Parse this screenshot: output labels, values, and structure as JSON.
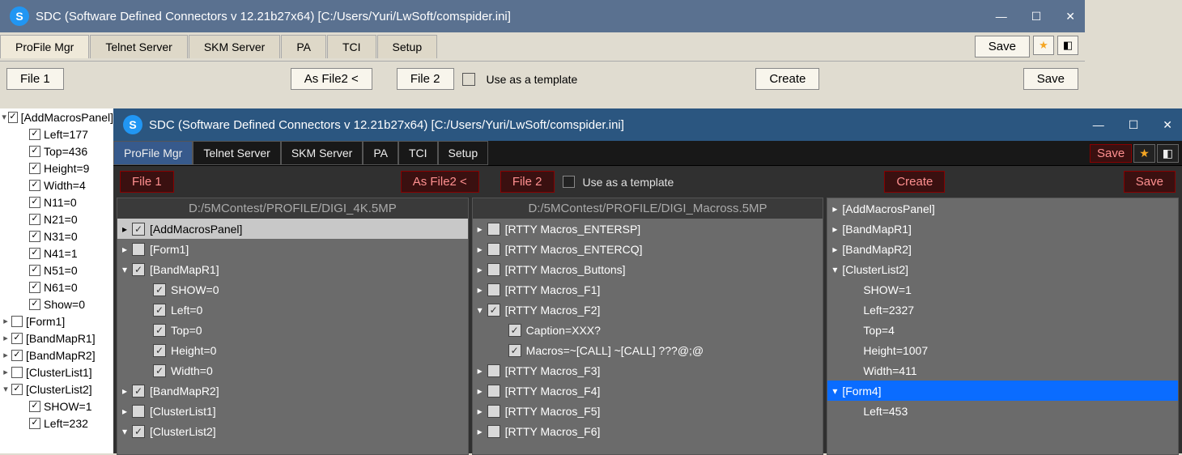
{
  "light": {
    "title": "SDC (Software Defined Connectors v 12.21b27x64) [C:/Users/Yuri/LwSoft/comspider.ini]",
    "tabs": [
      "ProFile Mgr",
      "Telnet Server",
      "SKM Server",
      "PA",
      "TCI",
      "Setup"
    ],
    "save": "Save",
    "file1": "File 1",
    "asfile2": "As File2 <",
    "file2": "File 2",
    "use_template": "Use as a template",
    "create": "Create",
    "save2": "Save",
    "tree": [
      {
        "d": 0,
        "tw": "▾",
        "cb": true,
        "t": "[AddMacrosPanel]"
      },
      {
        "d": 1,
        "tw": "",
        "cb": true,
        "t": "Left=177"
      },
      {
        "d": 1,
        "tw": "",
        "cb": true,
        "t": "Top=436"
      },
      {
        "d": 1,
        "tw": "",
        "cb": true,
        "t": "Height=9"
      },
      {
        "d": 1,
        "tw": "",
        "cb": true,
        "t": "Width=4"
      },
      {
        "d": 1,
        "tw": "",
        "cb": true,
        "t": "N11=0"
      },
      {
        "d": 1,
        "tw": "",
        "cb": true,
        "t": "N21=0"
      },
      {
        "d": 1,
        "tw": "",
        "cb": true,
        "t": "N31=0"
      },
      {
        "d": 1,
        "tw": "",
        "cb": true,
        "t": "N41=1"
      },
      {
        "d": 1,
        "tw": "",
        "cb": true,
        "t": "N51=0"
      },
      {
        "d": 1,
        "tw": "",
        "cb": true,
        "t": "N61=0"
      },
      {
        "d": 1,
        "tw": "",
        "cb": true,
        "t": "Show=0"
      },
      {
        "d": 0,
        "tw": "▸",
        "cb": false,
        "t": "[Form1]"
      },
      {
        "d": 0,
        "tw": "▸",
        "cb": true,
        "t": "[BandMapR1]"
      },
      {
        "d": 0,
        "tw": "▸",
        "cb": true,
        "t": "[BandMapR2]"
      },
      {
        "d": 0,
        "tw": "▸",
        "cb": false,
        "t": "[ClusterList1]"
      },
      {
        "d": 0,
        "tw": "▾",
        "cb": true,
        "t": "[ClusterList2]"
      },
      {
        "d": 1,
        "tw": "",
        "cb": true,
        "t": "SHOW=1"
      },
      {
        "d": 1,
        "tw": "",
        "cb": true,
        "t": "Left=232"
      }
    ]
  },
  "dark": {
    "title": "SDC (Software Defined Connectors v 12.21b27x64) [C:/Users/Yuri/LwSoft/comspider.ini]",
    "tabs": [
      "ProFile Mgr",
      "Telnet Server",
      "SKM Server",
      "PA",
      "TCI",
      "Setup"
    ],
    "save": "Save",
    "file1": "File 1",
    "asfile2": "As File2 <",
    "file2": "File 2",
    "use_template": "Use as a template",
    "create": "Create",
    "save2": "Save",
    "panel1": {
      "head": "D:/5MContest/PROFILE/DIGI_4K.5MP",
      "items": [
        {
          "d": 0,
          "tw": "▸",
          "cb": true,
          "t": "[AddMacrosPanel]",
          "sel": true
        },
        {
          "d": 0,
          "tw": "▸",
          "cb": false,
          "t": "[Form1]"
        },
        {
          "d": 0,
          "tw": "▾",
          "cb": true,
          "t": "[BandMapR1]"
        },
        {
          "d": 1,
          "tw": "",
          "cb": true,
          "t": "SHOW=0"
        },
        {
          "d": 1,
          "tw": "",
          "cb": true,
          "t": "Left=0"
        },
        {
          "d": 1,
          "tw": "",
          "cb": true,
          "t": "Top=0"
        },
        {
          "d": 1,
          "tw": "",
          "cb": true,
          "t": "Height=0"
        },
        {
          "d": 1,
          "tw": "",
          "cb": true,
          "t": "Width=0"
        },
        {
          "d": 0,
          "tw": "▸",
          "cb": true,
          "t": "[BandMapR2]"
        },
        {
          "d": 0,
          "tw": "▸",
          "cb": false,
          "t": "[ClusterList1]"
        },
        {
          "d": 0,
          "tw": "▾",
          "cb": true,
          "t": "[ClusterList2]"
        }
      ]
    },
    "panel2": {
      "head": "D:/5MContest/PROFILE/DIGI_Macross.5MP",
      "items": [
        {
          "d": 0,
          "tw": "▸",
          "cb": false,
          "t": "[RTTY Macros_ENTERSP]"
        },
        {
          "d": 0,
          "tw": "▸",
          "cb": false,
          "t": "[RTTY Macros_ENTERCQ]"
        },
        {
          "d": 0,
          "tw": "▸",
          "cb": false,
          "t": "[RTTY Macros_Buttons]"
        },
        {
          "d": 0,
          "tw": "▸",
          "cb": false,
          "t": "[RTTY Macros_F1]"
        },
        {
          "d": 0,
          "tw": "▾",
          "cb": true,
          "t": "[RTTY Macros_F2]"
        },
        {
          "d": 1,
          "tw": "",
          "cb": true,
          "t": "Caption=XXX?"
        },
        {
          "d": 1,
          "tw": "",
          "cb": true,
          "t": "Macros=~[CALL] ~[CALL] ???@;@"
        },
        {
          "d": 0,
          "tw": "▸",
          "cb": false,
          "t": "[RTTY Macros_F3]"
        },
        {
          "d": 0,
          "tw": "▸",
          "cb": false,
          "t": "[RTTY Macros_F4]"
        },
        {
          "d": 0,
          "tw": "▸",
          "cb": false,
          "t": "[RTTY Macros_F5]"
        },
        {
          "d": 0,
          "tw": "▸",
          "cb": false,
          "t": "[RTTY Macros_F6]"
        }
      ]
    },
    "panel3": {
      "items": [
        {
          "d": 0,
          "tw": "▸",
          "t": "[AddMacrosPanel]"
        },
        {
          "d": 0,
          "tw": "▸",
          "t": "[BandMapR1]"
        },
        {
          "d": 0,
          "tw": "▸",
          "t": "[BandMapR2]"
        },
        {
          "d": 0,
          "tw": "▾",
          "t": "[ClusterList2]"
        },
        {
          "d": 1,
          "tw": "",
          "t": "SHOW=1"
        },
        {
          "d": 1,
          "tw": "",
          "t": "Left=2327"
        },
        {
          "d": 1,
          "tw": "",
          "t": "Top=4"
        },
        {
          "d": 1,
          "tw": "",
          "t": "Height=1007"
        },
        {
          "d": 1,
          "tw": "",
          "t": "Width=411"
        },
        {
          "d": 0,
          "tw": "▾",
          "t": "[Form4]",
          "hl": true
        },
        {
          "d": 1,
          "tw": "",
          "t": "Left=453"
        }
      ]
    }
  }
}
